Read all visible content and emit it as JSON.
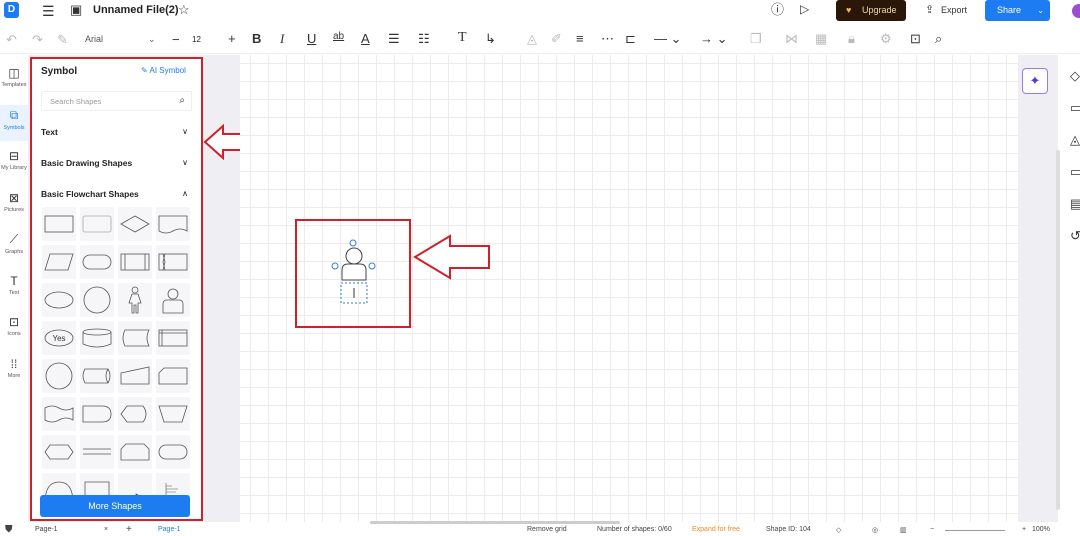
{
  "header": {
    "title": "Unnamed File(2)",
    "upgrade": "Upgrade",
    "export": "Export",
    "share": "Share"
  },
  "toolbar": {
    "font": "Arial",
    "font_size": "12"
  },
  "rail": [
    {
      "label": "Templates",
      "icon": "template-icon"
    },
    {
      "label": "Symbols",
      "icon": "symbols-icon"
    },
    {
      "label": "My Library",
      "icon": "library-icon"
    },
    {
      "label": "Pictures",
      "icon": "picture-icon"
    },
    {
      "label": "Graphs",
      "icon": "graph-icon"
    },
    {
      "label": "Text",
      "icon": "text-icon"
    },
    {
      "label": "Icons",
      "icon": "icons-icon"
    },
    {
      "label": "More",
      "icon": "more-icon"
    }
  ],
  "panel": {
    "title": "Symbol",
    "ai_symbol": "AI Symbol",
    "search_placeholder": "Search Shapes",
    "sections": [
      "Text",
      "Basic Drawing Shapes",
      "Basic Flowchart Shapes"
    ],
    "shapes": [
      "rect",
      "rect-light",
      "diamond",
      "document",
      "parallelogram",
      "terminator",
      "predefined",
      "collate-rect",
      "ellipse",
      "circle",
      "person",
      "user",
      "yes",
      "cylinder",
      "stored-data",
      "internal",
      "circle",
      "drum",
      "manual-input",
      "card",
      "tape",
      "delay",
      "display",
      "trapezoid",
      "hexagon",
      "lines",
      "rounded-notch",
      "stadium",
      "half-circle",
      "rect-bottom",
      "arrow-line",
      "note"
    ],
    "yes_label": "Yes",
    "more_shapes": "More Shapes"
  },
  "bottom": {
    "page_select": "Page-1",
    "page_tab": "Page-1",
    "remove_grid": "Remove grid",
    "shape_count": "Number of shapes: 0/60",
    "expand": "Expand for free",
    "shape_id": "Shape ID: 104",
    "zoom": "100%"
  },
  "colors": {
    "accent": "#1e7cf2",
    "highlight": "#d0202a",
    "upgrade_bg": "#2b160a"
  }
}
